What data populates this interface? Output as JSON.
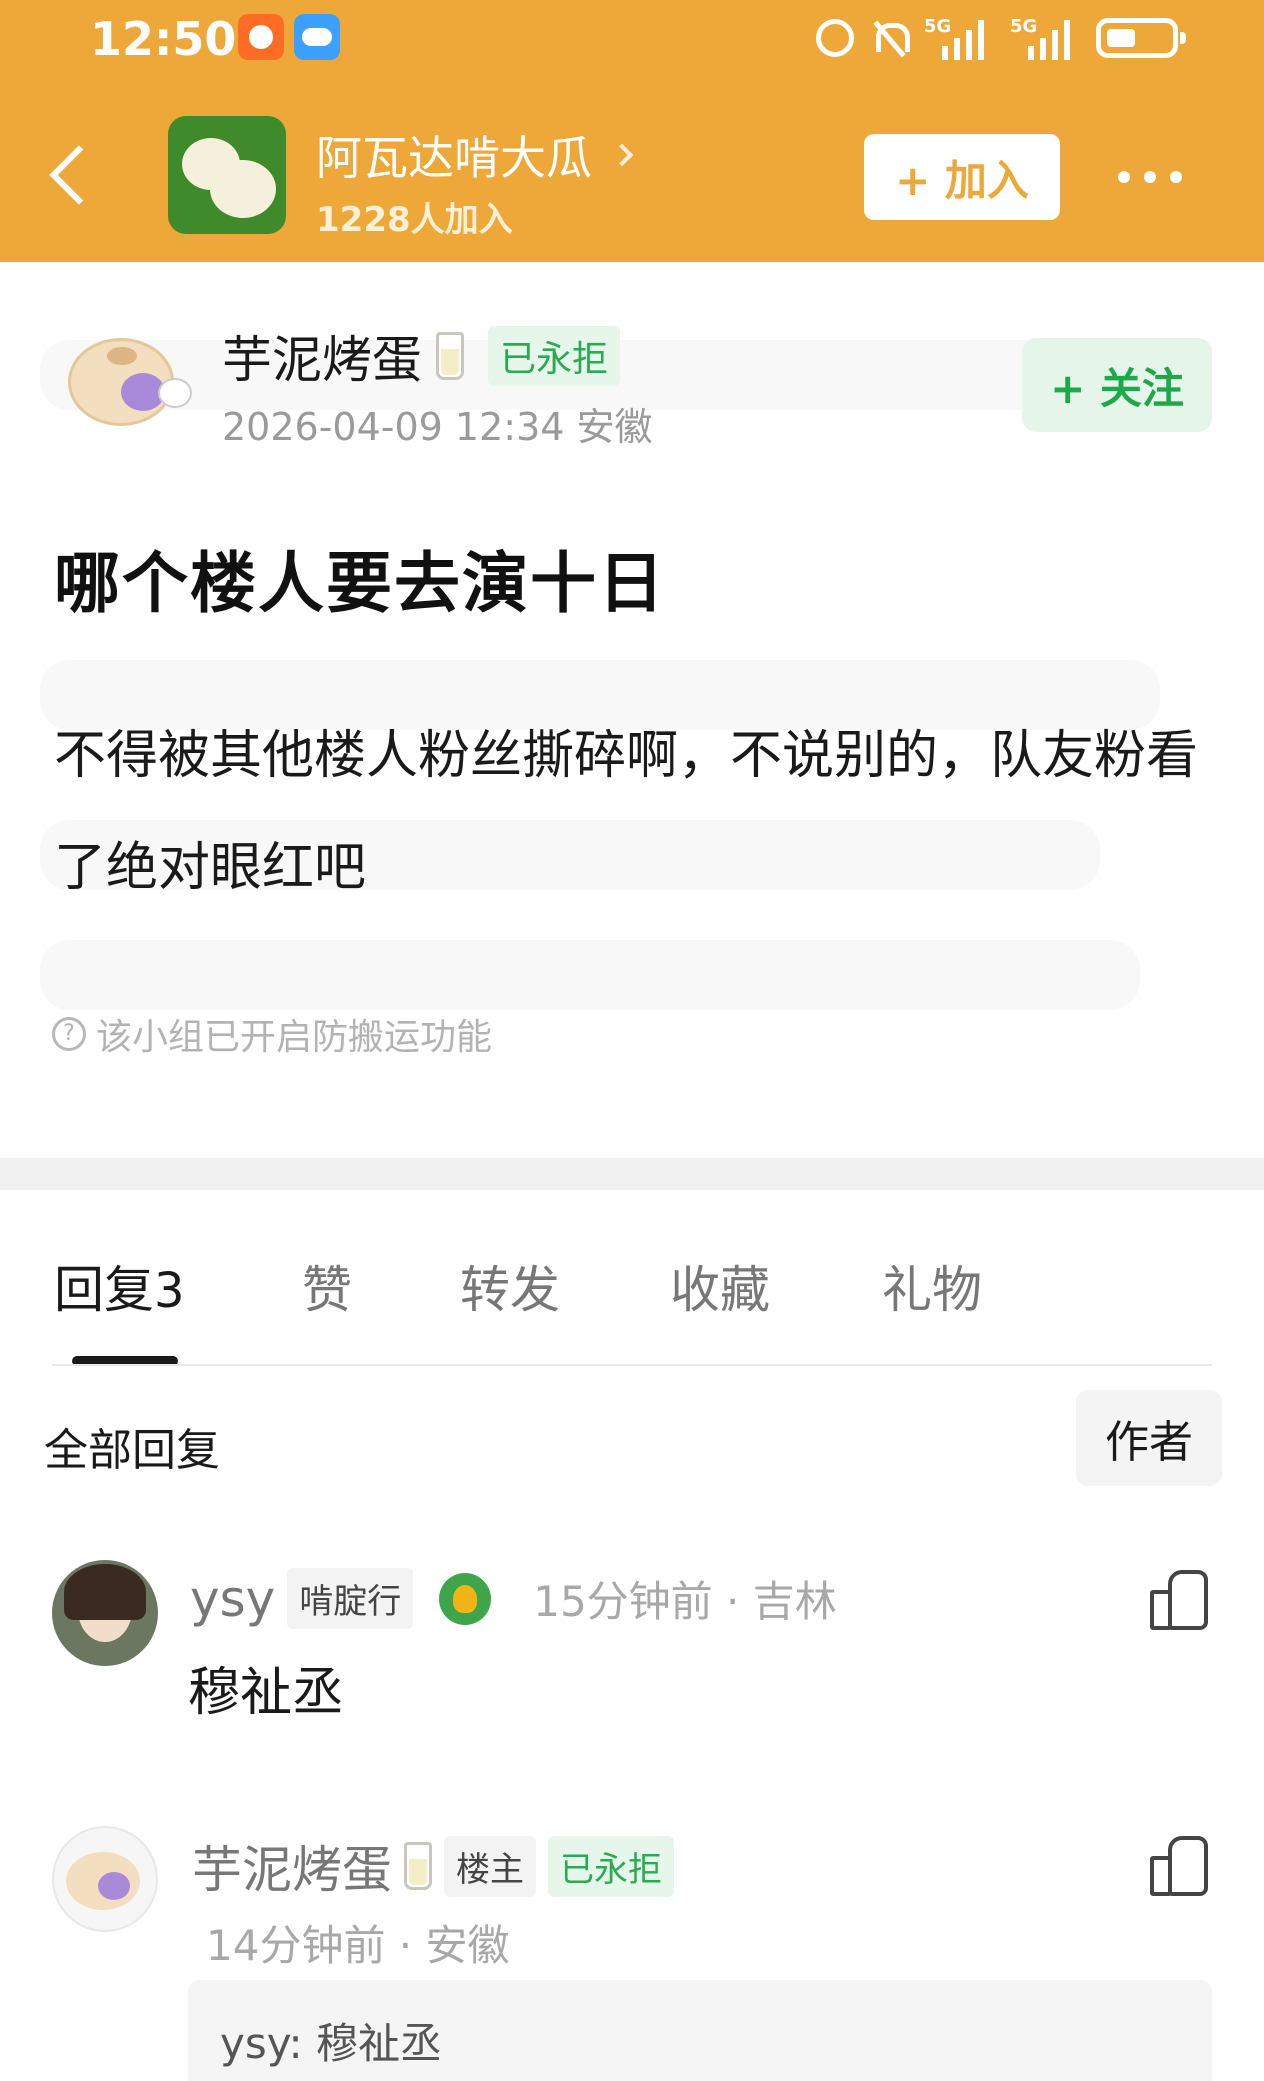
{
  "status_bar": {
    "time": "12:50",
    "net1": "5G",
    "net2": "5G"
  },
  "header": {
    "group_name": "阿瓦达啃大瓜",
    "members": "1228人加入",
    "join_label": "+ 加入",
    "accent_color": "#eea83a"
  },
  "post": {
    "author": "芋泥烤蛋",
    "author_badge": "已永拒",
    "meta": "2026-04-09 12:34  安徽",
    "follow_label": "+ 关注",
    "title": "哪个楼人要去演十日",
    "body": "不得被其他楼人粉丝撕碎啊，不说别的，队友粉看了绝对眼红吧",
    "anti_copy_note": "该小组已开启防搬运功能"
  },
  "tabs": [
    {
      "label": "回复",
      "count": "3",
      "active": true
    },
    {
      "label": "赞"
    },
    {
      "label": "转发"
    },
    {
      "label": "收藏"
    },
    {
      "label": "礼物"
    }
  ],
  "replies_header": {
    "title": "全部回复",
    "author_only": "作者"
  },
  "comments": [
    {
      "name": "ysy",
      "tag": "啃腚行",
      "meta": "15分钟前 · 吉林",
      "text": "穆祉丞",
      "icon": "flower-badge-icon"
    },
    {
      "name": "芋泥烤蛋",
      "tag_owner": "楼主",
      "tag_banned": "已永拒",
      "meta": "14分钟前 · 安徽",
      "quote": "ysy: 穆祉丞"
    }
  ]
}
